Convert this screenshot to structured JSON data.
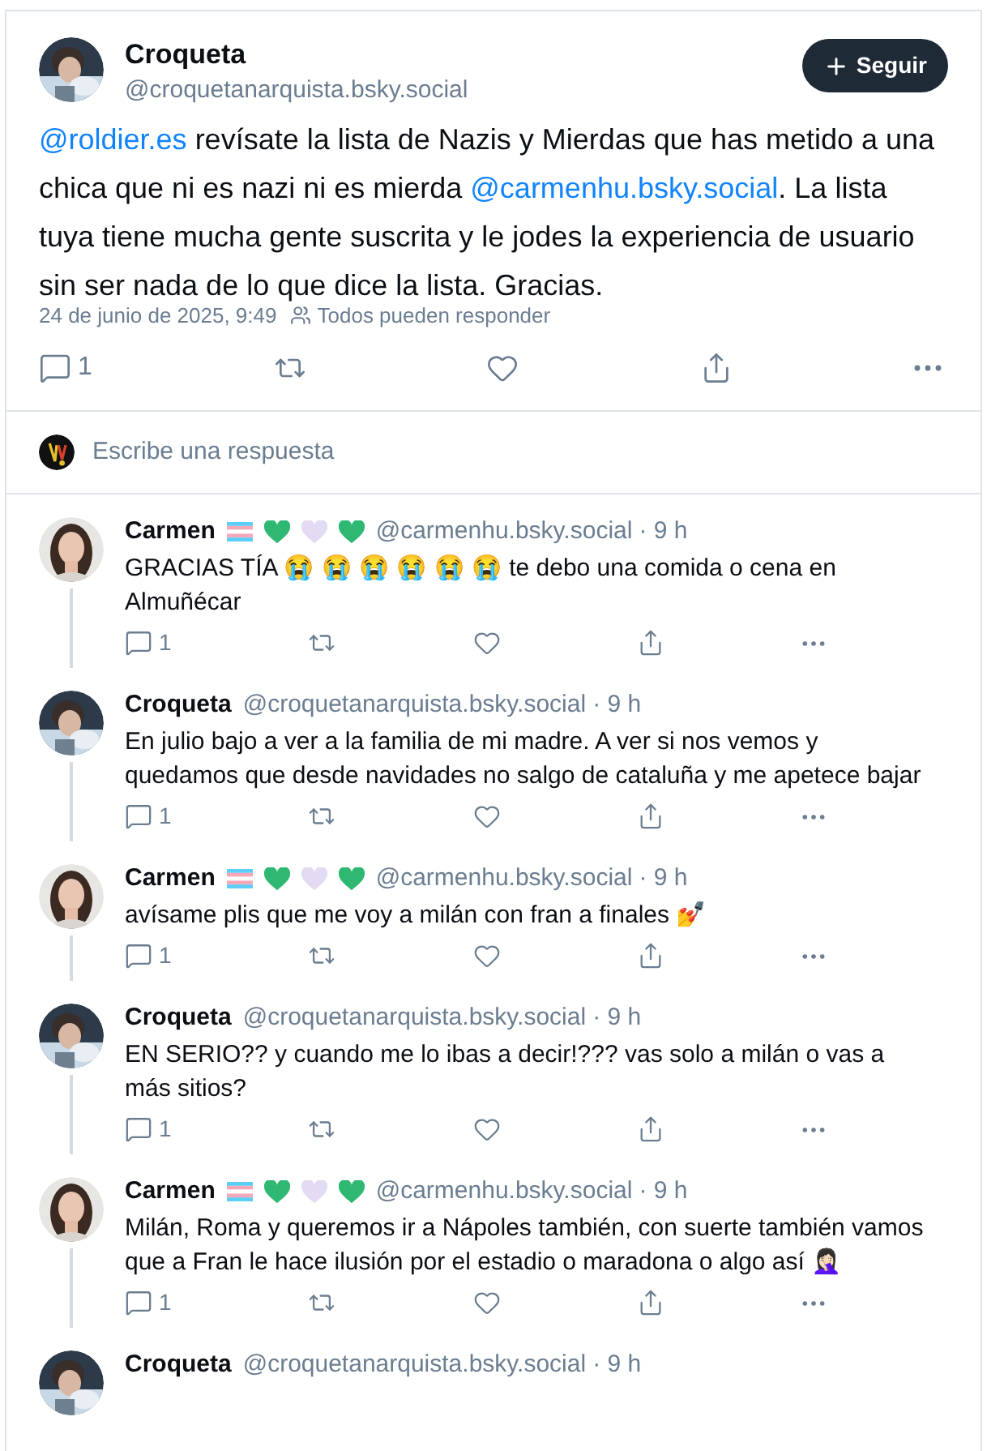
{
  "post": {
    "author": {
      "name": "Croqueta",
      "handle": "@croquetanarquista.bsky.social"
    },
    "follow_button": {
      "label": "Seguir"
    },
    "body": [
      {
        "kind": "mention",
        "text": "@roldier.es"
      },
      {
        "kind": "text",
        "text": " revísate la lista de Nazis y Mierdas que has metido a una chica que ni es nazi ni es mierda "
      },
      {
        "kind": "mention",
        "text": "@carmenhu.bsky.social"
      },
      {
        "kind": "text",
        "text": ". La lista tuya tiene mucha gente suscrita y le jodes la experiencia de usuario sin ser nada de lo que dice la lista. Gracias."
      }
    ],
    "timestamp": "24 de junio de 2025, 9:49",
    "reply_setting": "Todos pueden responder",
    "actions": [
      {
        "kind": "reply",
        "count": "1"
      },
      {
        "kind": "repost"
      },
      {
        "kind": "like"
      },
      {
        "kind": "share"
      },
      {
        "kind": "more"
      }
    ]
  },
  "composer": {
    "placeholder": "Escribe una respuesta"
  },
  "replies": [
    {
      "author": {
        "name": "Carmen",
        "avatar": {
          "kind": "woman"
        },
        "badges": [
          {
            "kind": "flag"
          },
          {
            "kind": "heart",
            "color": "#2eb872"
          },
          {
            "kind": "heart",
            "color": "#e3dbf3"
          },
          {
            "kind": "heart",
            "color": "#2eb872"
          }
        ],
        "handle": "@carmenhu.bsky.social"
      },
      "time": "· 9 h",
      "text": "GRACIAS TÍA 😭 😭 😭 😭 😭 😭 te debo una comida o cena en Almuñécar",
      "actions": [
        {
          "kind": "reply",
          "count": "1"
        },
        {
          "kind": "repost"
        },
        {
          "kind": "like"
        },
        {
          "kind": "share"
        },
        {
          "kind": "more"
        }
      ]
    },
    {
      "author": {
        "name": "Croqueta",
        "avatar": {
          "kind": "smoker"
        },
        "handle": "@croquetanarquista.bsky.social"
      },
      "time": "· 9 h",
      "text": "En julio bajo a ver a la familia de mi madre. A ver si nos vemos y quedamos que desde navidades no salgo de cataluña y me apetece bajar",
      "actions": [
        {
          "kind": "reply",
          "count": "1"
        },
        {
          "kind": "repost"
        },
        {
          "kind": "like"
        },
        {
          "kind": "share"
        },
        {
          "kind": "more"
        }
      ]
    },
    {
      "author": {
        "name": "Carmen",
        "avatar": {
          "kind": "woman"
        },
        "badges": [
          {
            "kind": "flag"
          },
          {
            "kind": "heart",
            "color": "#2eb872"
          },
          {
            "kind": "heart",
            "color": "#e3dbf3"
          },
          {
            "kind": "heart",
            "color": "#2eb872"
          }
        ],
        "handle": "@carmenhu.bsky.social"
      },
      "time": "· 9 h",
      "text": "avísame plis que me voy a milán con fran a finales 💅",
      "actions": [
        {
          "kind": "reply",
          "count": "1"
        },
        {
          "kind": "repost"
        },
        {
          "kind": "like"
        },
        {
          "kind": "share"
        },
        {
          "kind": "more"
        }
      ]
    },
    {
      "author": {
        "name": "Croqueta",
        "avatar": {
          "kind": "smoker"
        },
        "handle": "@croquetanarquista.bsky.social"
      },
      "time": "· 9 h",
      "text": "EN SERIO?? y cuando me lo ibas a decir!??? vas solo a milán o vas a más sitios?",
      "actions": [
        {
          "kind": "reply",
          "count": "1"
        },
        {
          "kind": "repost"
        },
        {
          "kind": "like"
        },
        {
          "kind": "share"
        },
        {
          "kind": "more"
        }
      ]
    },
    {
      "author": {
        "name": "Carmen",
        "avatar": {
          "kind": "woman"
        },
        "badges": [
          {
            "kind": "flag"
          },
          {
            "kind": "heart",
            "color": "#2eb872"
          },
          {
            "kind": "heart",
            "color": "#e3dbf3"
          },
          {
            "kind": "heart",
            "color": "#2eb872"
          }
        ],
        "handle": "@carmenhu.bsky.social"
      },
      "time": "· 9 h",
      "text": "Milán, Roma y queremos ir a Nápoles también, con suerte también vamos que a Fran le hace ilusión por el estadio o maradona o algo así 🤦🏻‍♀️",
      "actions": [
        {
          "kind": "reply",
          "count": "1"
        },
        {
          "kind": "repost"
        },
        {
          "kind": "like"
        },
        {
          "kind": "share"
        },
        {
          "kind": "more"
        }
      ]
    },
    {
      "author": {
        "name": "Croqueta",
        "avatar": {
          "kind": "smoker"
        },
        "handle": "@croquetanarquista.bsky.social"
      },
      "time": "· 9 h"
    }
  ]
}
